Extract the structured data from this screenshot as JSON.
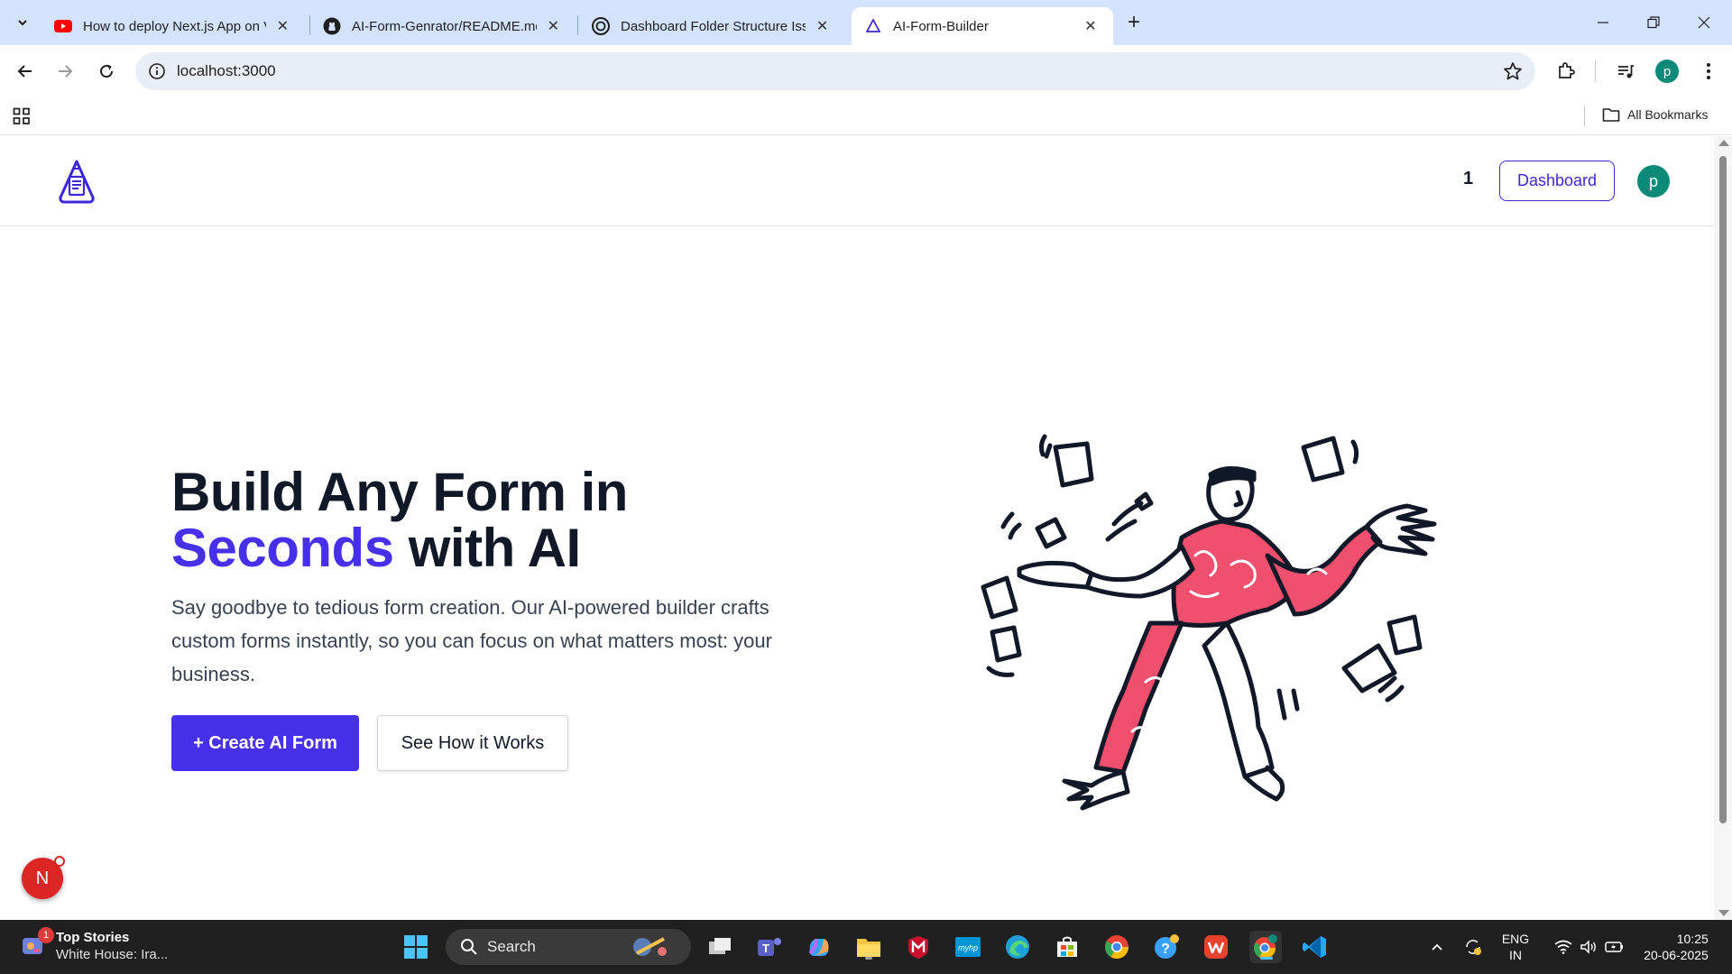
{
  "browser": {
    "tabs": [
      {
        "title": "How to deploy Next.js App on V",
        "favicon": "youtube-icon"
      },
      {
        "title": "AI-Form-Genrator/README.md",
        "favicon": "github-icon"
      },
      {
        "title": "Dashboard Folder Structure Issu",
        "favicon": "chatgpt-icon"
      },
      {
        "title": "AI-Form-Builder",
        "favicon": "app-logo-icon",
        "active": true
      }
    ],
    "url": "localhost:3000",
    "profile_initial": "p",
    "bookmarks_label": "All Bookmarks"
  },
  "header": {
    "notification_count": "1",
    "dashboard_label": "Dashboard",
    "avatar_initial": "p"
  },
  "hero": {
    "title_line1": "Build Any Form in",
    "title_accent": "Seconds",
    "title_rest": " with AI",
    "subtitle": "Say goodbye to tedious form creation. Our AI-powered builder crafts custom forms instantly, so you can focus on what matters most: your business.",
    "primary_cta": "+ Create AI Form",
    "secondary_cta": "See How it Works"
  },
  "dev_badge": {
    "letter": "N"
  },
  "taskbar": {
    "news_title": "Top Stories",
    "news_subtitle": "White House: Ira...",
    "news_badge": "1",
    "search_label": "Search",
    "lang_line1": "ENG",
    "lang_line2": "IN",
    "time": "10:25",
    "date": "20-06-2025"
  },
  "colors": {
    "accent": "#4630eb",
    "tabbar": "#d3e3fd",
    "profile": "#0b8a7a",
    "illustration_shirt": "#f0506e"
  }
}
